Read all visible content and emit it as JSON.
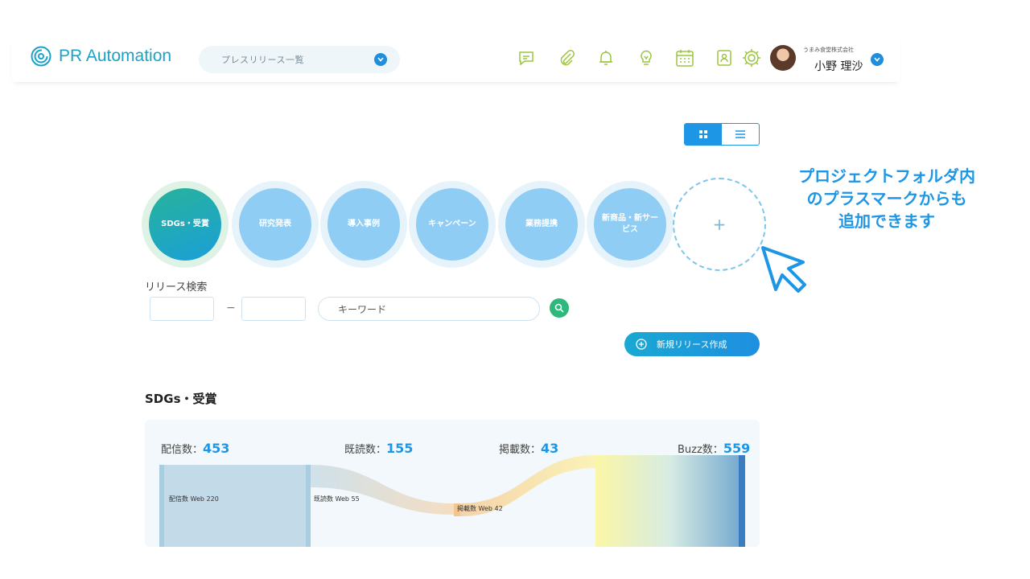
{
  "header": {
    "logo_text": "PR Automation",
    "nav_select": "プレスリリース一覧",
    "toolbar_icons": [
      "chat-icon",
      "paperclip-icon",
      "bell-icon",
      "lightbulb-icon",
      "calendar-icon",
      "contact-icon",
      "gear-icon"
    ],
    "user": {
      "company": "うまみ食堂株式会社",
      "name": "小野 理沙"
    }
  },
  "view_toggle": {
    "active": "grid"
  },
  "categories": [
    {
      "label": "SDGs・受賞",
      "active": true
    },
    {
      "label": "研究発表"
    },
    {
      "label": "導入事例"
    },
    {
      "label": "キャンペーン"
    },
    {
      "label": "業務提携"
    },
    {
      "label": "新商品・新サービス"
    }
  ],
  "add_category": {
    "symbol": "+"
  },
  "hint": {
    "line1": "プロジェクトフォルダ内",
    "line2": "のプラスマークからも",
    "line3": "追加できます"
  },
  "search": {
    "label": "リリース検索",
    "dash": "−",
    "keyword_placeholder": "キーワード",
    "new_release_label": "新規リリース作成"
  },
  "section": {
    "title": "SDGs・受賞"
  },
  "stats": {
    "delivered_label": "配信数：",
    "delivered": "453",
    "read_label": "既読数：",
    "read": "155",
    "posted_label": "掲載数：",
    "posted": "43",
    "buzz_label": "Buzz数：",
    "buzz": "559"
  },
  "sankey": {
    "nodes": [
      {
        "label": "配信数 Web 220"
      },
      {
        "label": "既読数 Web 55"
      },
      {
        "label": "掲載数 Web 42"
      }
    ]
  },
  "colors": {
    "accent": "#1e96e6",
    "teal": "#1aa3c6",
    "green": "#2db87d"
  }
}
